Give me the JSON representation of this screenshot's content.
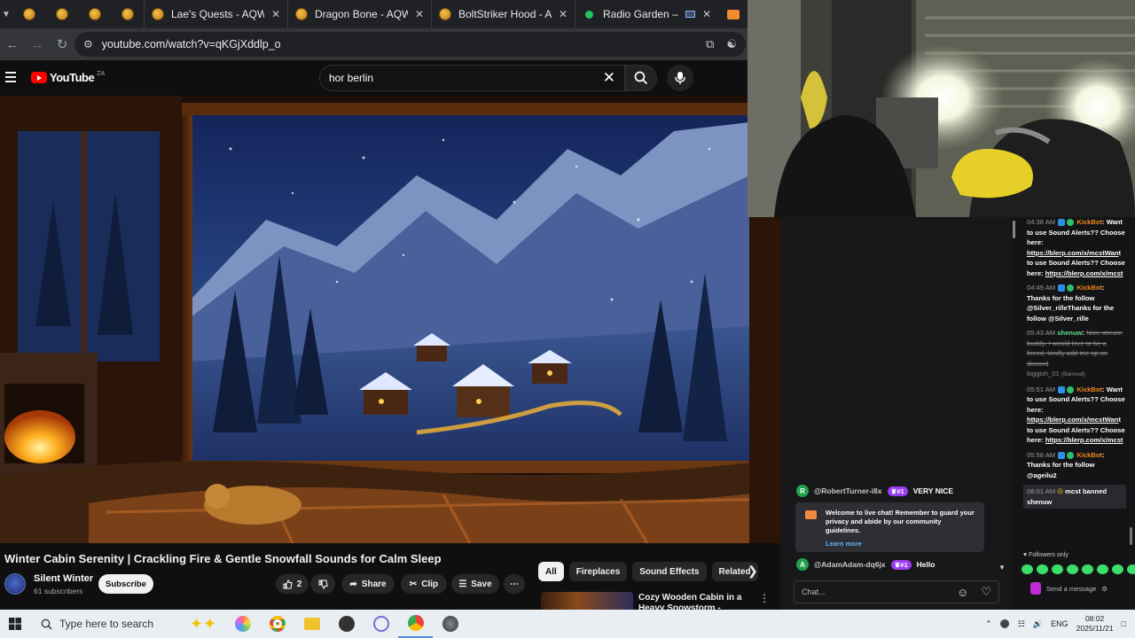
{
  "browser": {
    "tabs": [
      {
        "title": "Lae's Quests - AQW"
      },
      {
        "title": "Dragon Bone - AQW"
      },
      {
        "title": "BoltStriker Hood - AQW"
      },
      {
        "title": "Radio Garden – Glob"
      }
    ],
    "url": "youtube.com/watch?v=qKGjXddlp_o"
  },
  "youtube": {
    "logo_text": "YouTube",
    "region": "ZA",
    "search_value": "hor berlin",
    "video": {
      "title": "Winter Cabin Serenity | Crackling Fire & Gentle Snowfall Sounds for Calm Sleep",
      "channel": "Silent Winter",
      "subscribers": "61 subscribers",
      "subscribe_label": "Subscribe",
      "likes": "2",
      "share_label": "Share",
      "clip_label": "Clip",
      "save_label": "Save"
    },
    "chips": [
      "All",
      "Fireplaces",
      "Sound Effects",
      "Related"
    ],
    "recommended": {
      "title": "Cozy Wooden Cabin in a Heavy Snowstorm - Crackling"
    }
  },
  "stream_chat": {
    "mid": [
      {
        "avatar": "R",
        "user": "@RobertTurner-i8x",
        "badge": "#1",
        "message": "VERY NICE"
      },
      {
        "avatar": "A",
        "user": "@AdamAdam-dq6jx",
        "badge": "#1",
        "message": "Hello"
      }
    ],
    "notice": "Welcome to live chat! Remember to guard your privacy and abide by our community guidelines.",
    "notice_link": "Learn more",
    "chat_placeholder": "Chat...",
    "right": {
      "m1_time": "04:38 AM",
      "m1_user": "KickBot",
      "m1_text": "Want to use Sound Alerts?? Choose here: ",
      "m1_link": "https://blerp.com/x/mcstWan",
      "m1_text2": "t to use Sound Alerts?? Choose here: ",
      "m1_link2": "https://blerp.com/x/mcst",
      "m2_time": "04:49 AM",
      "m2_user": "KickBot",
      "m2_text": "Thanks for the follow @Silver_rilleThanks for the follow @Silver_rille",
      "m3_time": "05:43 AM",
      "m3_user": "shenuw",
      "m3_text": "Nice stream buddy, I would love to be a friend, kindly add me up on discord",
      "m3_banned_name": "biggish_01",
      "m3_banned": "(Banned)",
      "m4_time": "05:51 AM",
      "m4_user": "KickBot",
      "m4_text": "Want to use Sound Alerts?? Choose here: ",
      "m4_link": "https://blerp.com/x/mcstWan",
      "m4_text2": "t to use Sound Alerts?? Choose here: ",
      "m4_link2": "https://blerp.com/x/mcst",
      "m5_time": "05:58 AM",
      "m5_user": "KickBot",
      "m5_text": "Thanks for the follow @ageilu2",
      "m6_time": "08:01 AM",
      "m6_text": "mcst banned shenuw",
      "followers_only": "Followers only",
      "send_label": "Send a message"
    }
  },
  "taskbar": {
    "search_placeholder": "Type here to search",
    "lang": "ENG",
    "time": "08:02",
    "date": "2025/11/21"
  }
}
